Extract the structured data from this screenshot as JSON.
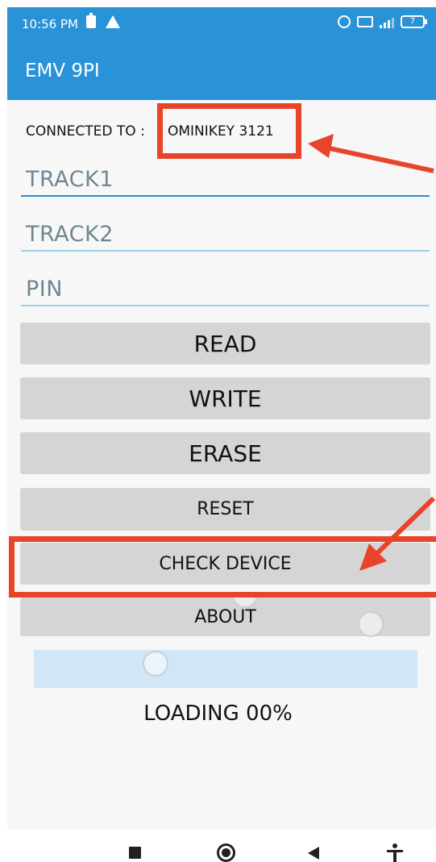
{
  "status_bar": {
    "time": "10:56 PM",
    "battery_level": "7"
  },
  "app_bar": {
    "title": "EMV 9PI"
  },
  "connection": {
    "label": "CONNECTED TO :",
    "device": "OMINIKEY 3121"
  },
  "fields": {
    "track1": "TRACK1",
    "track2": "TRACK2",
    "pin": "PIN"
  },
  "buttons": {
    "read": "READ",
    "write": "WRITE",
    "erase": "ERASE",
    "reset": "RESET",
    "check_device": "CHECK DEVICE",
    "about": "ABOUT"
  },
  "progress": {
    "value": 0,
    "text": "LOADING 00%"
  },
  "colors": {
    "primary": "#2a92d6",
    "annotation": "#e8442a",
    "button": "#d5d5d5"
  },
  "icons": [
    "battery-saver-icon",
    "warning-icon",
    "alarm-icon",
    "volte-icon",
    "signal-icon",
    "battery-icon",
    "recent-apps-icon",
    "home-icon",
    "back-icon",
    "accessibility-icon"
  ]
}
